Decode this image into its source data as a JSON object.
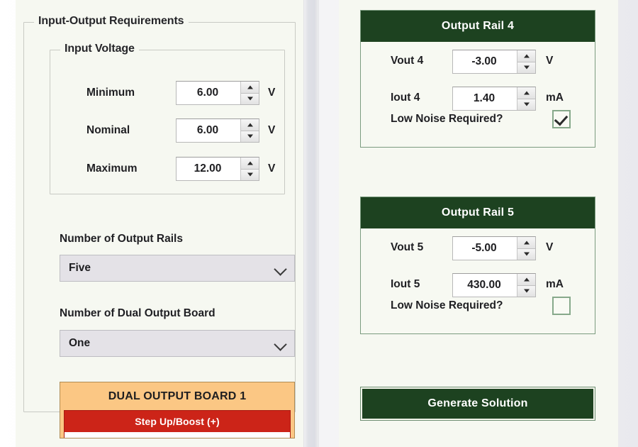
{
  "left_panel": {
    "group_title": "Input-Output Requirements",
    "input_voltage": {
      "legend": "Input Voltage",
      "rows": [
        {
          "label": "Minimum",
          "value": "6.00",
          "unit": "V"
        },
        {
          "label": "Nominal",
          "value": "6.00",
          "unit": "V"
        },
        {
          "label": "Maximum",
          "value": "12.00",
          "unit": "V"
        }
      ]
    },
    "output_rails_select": {
      "label": "Number of Output Rails",
      "value": "Five",
      "icon": "chevron-down-icon"
    },
    "dual_board_select": {
      "label": "Number of Dual Output Board",
      "value": "One",
      "icon": "chevron-down-icon"
    },
    "board_card": {
      "title": "DUAL OUTPUT BOARD 1",
      "subtitle": "Step Up/Boost (+)"
    }
  },
  "right_panel": {
    "rails": [
      {
        "title": "Output Rail 4",
        "vout_label": "Vout 4",
        "vout_value": "-3.00",
        "vout_unit": "V",
        "iout_label": "Iout 4",
        "iout_value": "1.40",
        "iout_unit": "mA",
        "low_noise_label": "Low Noise Required?",
        "low_noise_checked": true
      },
      {
        "title": "Output Rail 5",
        "vout_label": "Vout 5",
        "vout_value": "-5.00",
        "vout_unit": "V",
        "iout_label": "Iout 5",
        "iout_value": "430.00",
        "iout_unit": "mA",
        "low_noise_label": "Low Noise Required?",
        "low_noise_checked": false
      }
    ],
    "generate_button": "Generate Solution"
  },
  "colors": {
    "rail_header_green": "#1d4220",
    "panel_background": "#f6f8f1",
    "board_orange": "#fbc784",
    "board_red": "#cc2418",
    "checkbox_border_green": "#87a98b"
  }
}
